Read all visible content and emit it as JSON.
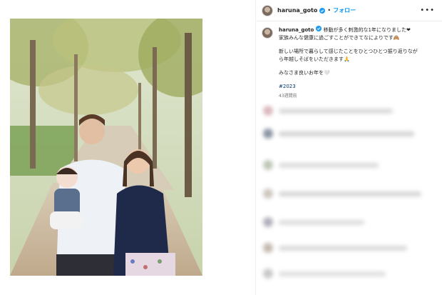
{
  "post": {
    "username": "haruna_goto",
    "follow_label": "フォロー",
    "separator": "•",
    "more_label": "•••",
    "caption_username": "haruna_goto",
    "caption_lines": [
      "移動が多く刺激的な1年になりました❤",
      "家族みんな健康に過ごすことができてなによりです🙈"
    ],
    "caption_lines_2": [
      "新しい場所で暮らして感じたことをひとつひとつ振り返りなが",
      "ら年越しそばをいただきます🙏"
    ],
    "caption_line_3": "みなさま良いお年を🤍",
    "hashtag": "#2023",
    "timestamp": "43週間前"
  },
  "colors": {
    "link_blue": "#0095f6",
    "hashtag_blue": "#00376b",
    "muted_gray": "#737373",
    "verified_blue": "#1d9bf0"
  },
  "icons": {
    "verified": "verified-badge-icon",
    "more": "more-options-icon"
  }
}
